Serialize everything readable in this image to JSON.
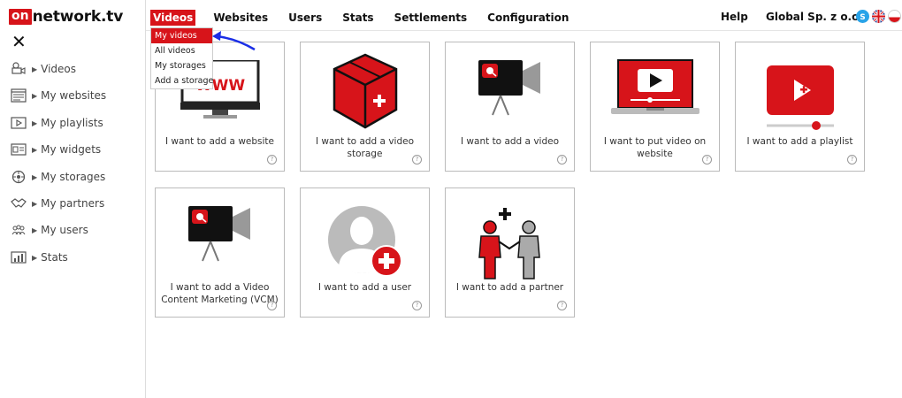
{
  "brand": {
    "on": "on",
    "rest": "network.tv"
  },
  "close_symbol": "✕",
  "sidebar": {
    "items": [
      {
        "label": "Videos",
        "icon": "video-camera-icon"
      },
      {
        "label": "My websites",
        "icon": "website-icon"
      },
      {
        "label": "My playlists",
        "icon": "playlist-icon"
      },
      {
        "label": "My widgets",
        "icon": "widget-icon"
      },
      {
        "label": "My storages",
        "icon": "storage-icon"
      },
      {
        "label": "My partners",
        "icon": "handshake-icon"
      },
      {
        "label": "My users",
        "icon": "users-icon"
      },
      {
        "label": "Stats",
        "icon": "stats-icon"
      }
    ]
  },
  "topnav": {
    "items": [
      "Videos",
      "Websites",
      "Users",
      "Stats",
      "Settlements",
      "Configuration"
    ],
    "help": "Help",
    "account": "Global Sp. z o.o."
  },
  "dropdown": {
    "items": [
      "My videos",
      "All videos",
      "My storages",
      "Add a storage"
    ]
  },
  "cards": [
    {
      "label": "I want to add a website",
      "icon": "monitor-www-icon"
    },
    {
      "label": "I want to add a video storage",
      "icon": "red-box-icon"
    },
    {
      "label": "I want to add a video",
      "icon": "video-camera-icon"
    },
    {
      "label": "I want to put video on website",
      "icon": "laptop-play-icon"
    },
    {
      "label": "I want to add a playlist",
      "icon": "playlist-player-icon"
    },
    {
      "label": "I want to add a Video Content Marketing (VCM)",
      "icon": "video-camera-icon"
    },
    {
      "label": "I want to add a user",
      "icon": "user-add-icon"
    },
    {
      "label": "I want to add a partner",
      "icon": "partner-add-icon"
    }
  ],
  "help_symbol": "?",
  "colors": {
    "brand_red": "#d7141a",
    "arrow_blue": "#1a2ee6",
    "card_border": "#bbbbbb"
  }
}
